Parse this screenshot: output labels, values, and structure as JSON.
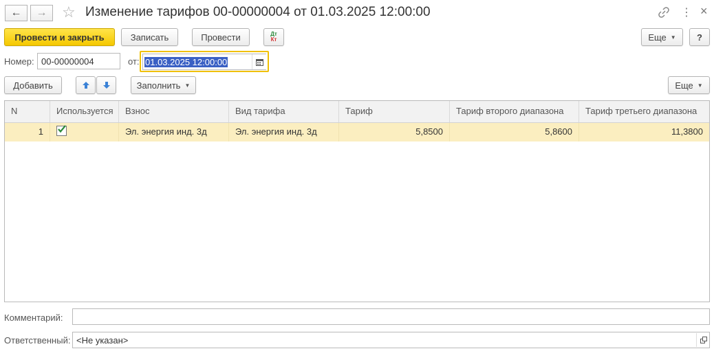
{
  "window": {
    "title": "Изменение тарифов 00-00000004 от 01.03.2025 12:00:00",
    "back_icon": "←",
    "forward_icon": "→",
    "star_icon": "☆",
    "link_icon": "link-icon",
    "menu_icon": "⋮",
    "close_icon": "×"
  },
  "toolbar": {
    "post_close": "Провести и закрыть",
    "save": "Записать",
    "post": "Провести",
    "dtkt_top": "Дт",
    "dtkt_bottom": "Кт",
    "more": "Еще",
    "help": "?"
  },
  "header": {
    "number_label": "Номер:",
    "number_value": "00-00000004",
    "date_label": "от:",
    "date_value": "01.03.2025 12:00:00"
  },
  "table_toolbar": {
    "add": "Добавить",
    "fill": "Заполнить",
    "more": "Еще"
  },
  "table": {
    "columns": [
      "N",
      "Используется",
      "Взнос",
      "Вид тарифа",
      "Тариф",
      "Тариф второго диапазона",
      "Тариф третьего диапазона"
    ],
    "rows": [
      {
        "n": "1",
        "used": true,
        "contribution": "Эл. энергия инд. 3д",
        "tariff_type": "Эл. энергия инд. 3д",
        "tariff": "5,8500",
        "tariff2": "5,8600",
        "tariff3": "11,3800"
      }
    ]
  },
  "footer": {
    "comment_label": "Комментарий:",
    "comment_value": "",
    "responsible_label": "Ответственный:",
    "responsible_value": "<Не указан>"
  },
  "colors": {
    "primary_button": "#f5c800",
    "selected_row": "#fbeec0",
    "focus_border": "#f0c000",
    "checkbox_green": "#2a8a3a"
  }
}
